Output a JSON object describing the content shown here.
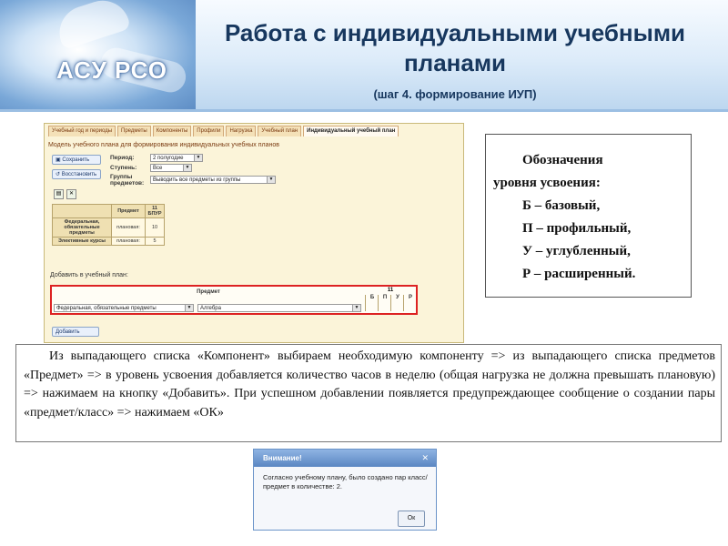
{
  "header": {
    "title": "Работа с индивидуальными учебными планами",
    "subtitle": "(шаг 4. формирование ИУП)",
    "logo": "АСУ РСО"
  },
  "app": {
    "tabs": [
      "Учебный год и периоды",
      "Предметы",
      "Компоненты",
      "Профили",
      "Нагрузка",
      "Учебный план",
      "Индивидуальный учебный план"
    ],
    "active_tab": "Индивидуальный учебный план",
    "heading": "Модель учебного плана для формирования индивидуальных учебных планов",
    "buttons": {
      "save": "Сохранить",
      "restore": "Восстановить",
      "add": "Добавить"
    },
    "filters": {
      "period_label": "Период:",
      "period_value": "2 полугодие",
      "stage_label": "Ступень:",
      "stage_value": "Все",
      "groups_label": "Группы предметов:",
      "groups_value": "Выводить все предметы из группы"
    },
    "plan_table": {
      "headers": [
        "",
        "Предмет",
        "11 БПУР"
      ],
      "rows": [
        [
          "Федеральная, обязательные предметы",
          "плановая:",
          "10"
        ],
        [
          "Элективные курсы",
          "плановая:",
          "5"
        ]
      ]
    },
    "add_section": {
      "title": "Добавить в учебный план:",
      "subject_header": "Предмет",
      "grade": "11",
      "levels": [
        "Б",
        "П",
        "У",
        "Р"
      ],
      "component_value": "Федеральная, обязательные предметы",
      "subject_value": "Алгебра"
    }
  },
  "legend": {
    "lines": [
      "Обозначения",
      "уровня усвоения:",
      "Б – базовый,",
      "П – профильный,",
      "У – углубленный,",
      "Р – расширенный."
    ]
  },
  "description": "Из выпадающего списка «Компонент» выбираем необходимую компоненту => из выпадающего списка предметов «Предмет» => в уровень усвоения добавляется количество часов в неделю (общая нагрузка не должна превышать плановую) => нажимаем на кнопку «Добавить». При успешном добавлении появляется предупреждающее сообщение о создании пары «предмет/класс» => нажимаем «ОК»",
  "dialog": {
    "title": "Внимание!",
    "message": "Согласно учебному плану, было создано пар класс/предмет в количестве: 2.",
    "ok": "Ок"
  }
}
